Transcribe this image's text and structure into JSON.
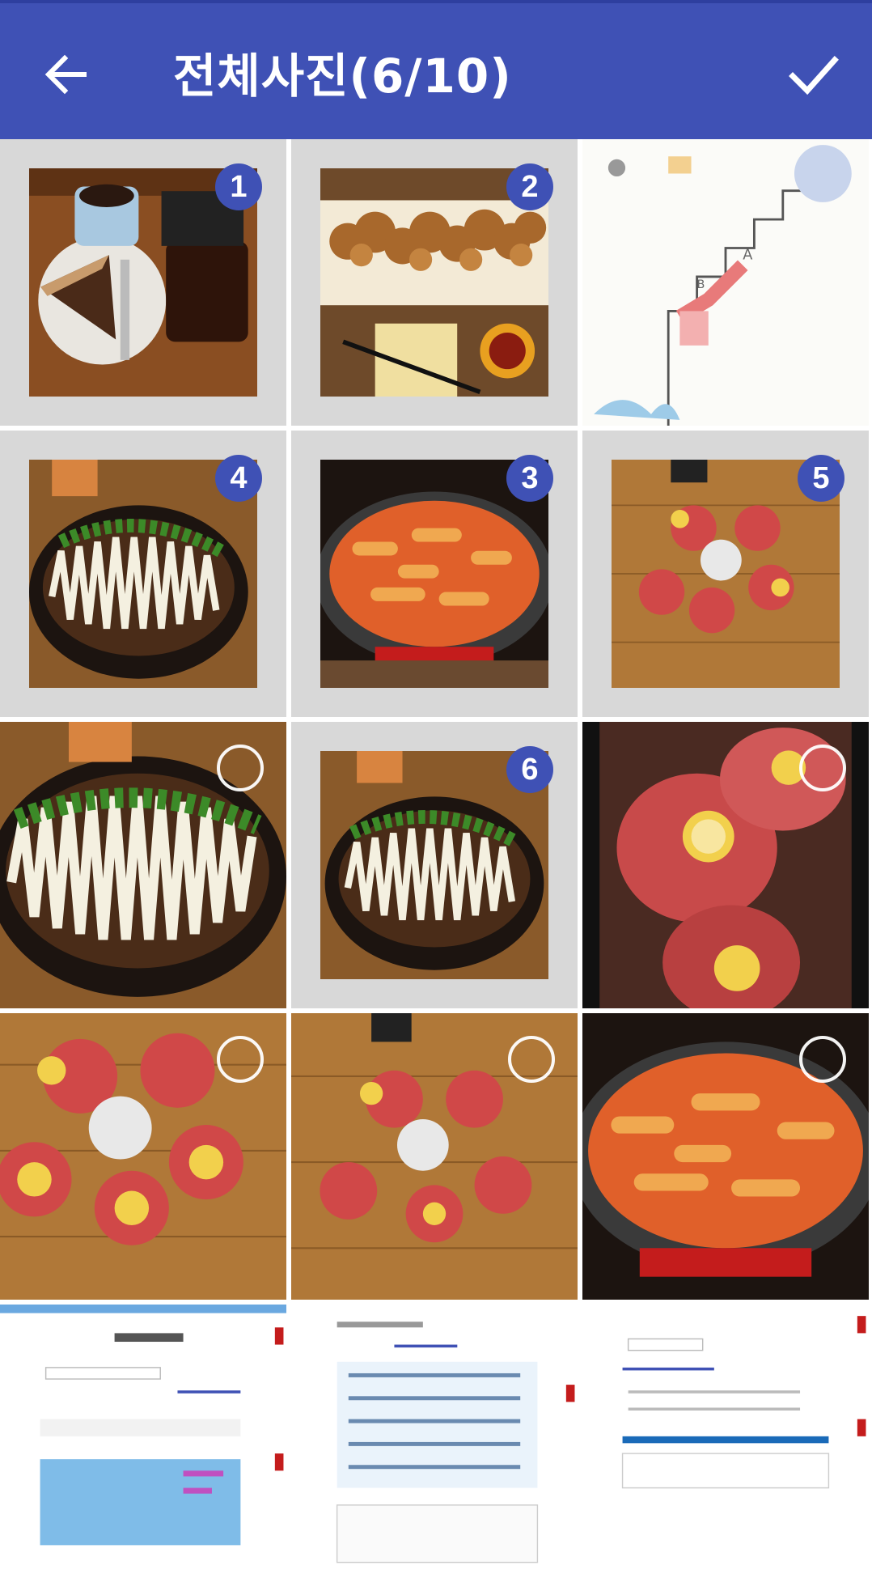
{
  "appbar": {
    "title": "전체사진(6/10)",
    "back_icon": "arrow-left-icon",
    "done_icon": "check-icon",
    "color": "#3f51b5"
  },
  "photos": [
    {
      "id": "cake-coffee",
      "selected_order": "1"
    },
    {
      "id": "fried-chicken",
      "selected_order": "2"
    },
    {
      "id": "map-sketch",
      "selected_order": ""
    },
    {
      "id": "okonomiyaki-a",
      "selected_order": "4"
    },
    {
      "id": "tteokbokki-a",
      "selected_order": "3"
    },
    {
      "id": "drinks-a",
      "selected_order": "5"
    },
    {
      "id": "okonomiyaki-b",
      "selected_order": ""
    },
    {
      "id": "okonomiyaki-c",
      "selected_order": "6"
    },
    {
      "id": "drinks-closeup",
      "selected_order": ""
    },
    {
      "id": "drinks-b",
      "selected_order": ""
    },
    {
      "id": "drinks-c",
      "selected_order": ""
    },
    {
      "id": "tteokbokki-b",
      "selected_order": ""
    },
    {
      "id": "screenshot-a",
      "selected_order": ""
    },
    {
      "id": "screenshot-b",
      "selected_order": ""
    },
    {
      "id": "screenshot-c",
      "selected_order": ""
    }
  ]
}
